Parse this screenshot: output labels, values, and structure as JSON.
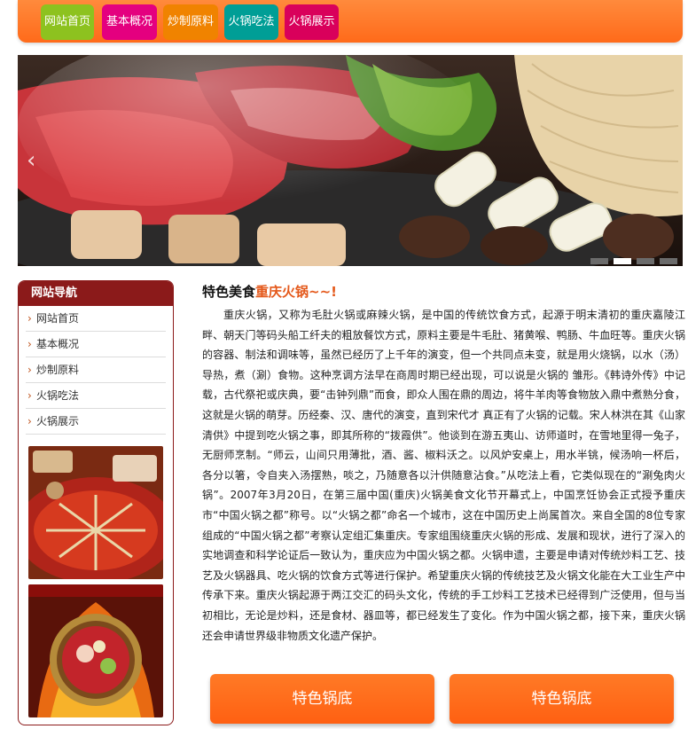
{
  "nav": {
    "items": [
      {
        "label": "网站首页",
        "color": "#8dc21f"
      },
      {
        "label": "基本概况",
        "color": "#e4007f"
      },
      {
        "label": "炒制原料",
        "color": "#f08300"
      },
      {
        "label": "火锅吃法",
        "color": "#009e96"
      },
      {
        "label": "火锅展示",
        "color": "#d9005b"
      }
    ]
  },
  "banner": {
    "prev_icon": "chevron-left-icon",
    "slide_count": 4,
    "active_slide": 2
  },
  "sidebar": {
    "title": "网站导航",
    "items": [
      "网站首页",
      "基本概况",
      "炒制原料",
      "火锅吃法",
      "火锅展示"
    ]
  },
  "main": {
    "title_prefix": "特色美食",
    "title_highlight": "重庆火锅~~!",
    "paragraph": "重庆火锅，又称为毛肚火锅或麻辣火锅，是中国的传统饮食方式，起源于明末清初的重庆嘉陵江畔、朝天门等码头船工纤夫的粗放餐饮方式，原料主要是牛毛肚、猪黄喉、鸭肠、牛血旺等。重庆火锅的容器、制法和调味等，虽然已经历了上千年的演变，但一个共同点未变，就是用火烧锅，以水（汤）导热，煮（涮）食物。这种烹调方法早在商周时期已经出现，可以说是火锅的 雏形。《韩诗外传》中记载，古代祭祀或庆典，要“击钟列鼎”而食，即众人围在鼎的周边，将牛羊肉等食物放入鼎中煮熟分食，这就是火锅的萌芽。历经秦、汉、唐代的演变，直到宋代才 真正有了火锅的记载。宋人林洪在其《山家清供》中提到吃火锅之事，即其所称的“拨霞供”。他谈到在游五夷山、访师道时，在雪地里得一兔子，无厨师烹制。“师云，山间只用薄批，酒、酱、椒料沃之。以风炉安桌上，用水半铫，候汤响一杯后，各分以箸，令自夹入汤摆熟，啖之，乃随意各以汁供随意沾食。”从吃法上看，它类似现在的“涮兔肉火锅”。2007年3月20日，在第三届中国(重庆)火锅美食文化节开幕式上，中国烹饪协会正式授予重庆市“中国火锅之都”称号。以“火锅之都”命名一个城市，这在中国历史上尚属首次。来自全国的8位专家组成的“中国火锅之都”考察认定组汇集重庆。专家组围绕重庆火锅的形成、发展和现状，进行了深入的实地调查和科学论证后一致认为，重庆应为中国火锅之都。火锅申遗，主要是申请对传统炒料工艺、技艺及火锅器具、吃火锅的饮食方式等进行保护。希望重庆火锅的传统技艺及火锅文化能在大工业生产中传承下来。重庆火锅起源于两江交汇的码头文化，传统的手工炒料工艺技术已经得到广泛使用，但与当初相比，无论是炒料，还是食材、器皿等，都已经发生了变化。作为中国火锅之都，接下来，重庆火锅还会申请世界级非物质文化遗产保护。"
  },
  "buttons": {
    "left": "特色锅底",
    "right": "特色锅底"
  }
}
